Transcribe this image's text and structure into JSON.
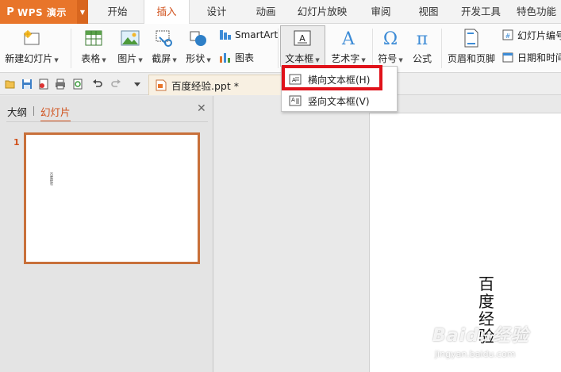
{
  "app": {
    "name": "WPS 演示",
    "logo": "P"
  },
  "tabs": [
    {
      "label": "开始"
    },
    {
      "label": "插入"
    },
    {
      "label": "设计"
    },
    {
      "label": "动画"
    },
    {
      "label": "幻灯片放映"
    },
    {
      "label": "审阅"
    },
    {
      "label": "视图"
    },
    {
      "label": "开发工具"
    },
    {
      "label": "特色功能"
    }
  ],
  "ribbon": {
    "new_slide": "新建幻灯片",
    "table": "表格",
    "picture": "图片",
    "screenshot": "截屏",
    "shape": "形状",
    "smartart": "SmartArt",
    "chart": "图表",
    "textbox": "文本框",
    "wordart": "艺术字",
    "symbol": "符号",
    "formula": "公式",
    "header_footer": "页眉和页脚",
    "slide_number": "幻灯片编号",
    "date_time": "日期和时间"
  },
  "document": {
    "tab_title": "百度经验.ppt *"
  },
  "panel": {
    "outline_tab": "大纲",
    "slides_tab": "幻灯片",
    "slide_index": "1"
  },
  "thumbnail": {
    "text": "百度经验"
  },
  "slide": {
    "vertical_text": "百度经验"
  },
  "menu": {
    "items": [
      {
        "label": "横向文本框(H)",
        "icon": "horizontal-textbox-icon"
      },
      {
        "label": "竖向文本框(V)",
        "icon": "vertical-textbox-icon"
      }
    ]
  },
  "watermark": {
    "logo": "Baidu经验",
    "url": "jingyan.baidu.com"
  },
  "colors": {
    "accent": "#d0501a",
    "wps_orange": "#e8752a",
    "highlight_red": "#e0121a"
  }
}
